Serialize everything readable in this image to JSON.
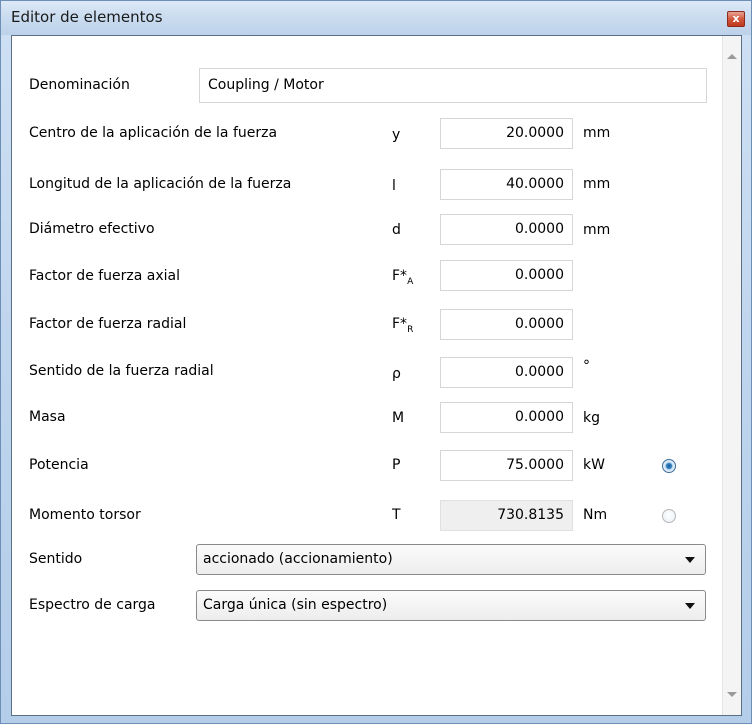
{
  "window": {
    "title": "Editor de elementos",
    "close_label": "x"
  },
  "form": {
    "denominacion": {
      "label": "Denominación",
      "value": "Coupling / Motor"
    },
    "rows": [
      {
        "label": "Centro de la aplicación de la fuerza",
        "symbol": "y",
        "value": "20.0000",
        "unit": "mm"
      },
      {
        "label": "Longitud de la aplicación de la fuerza",
        "symbol": "l",
        "value": "40.0000",
        "unit": "mm"
      },
      {
        "label": "Diámetro efectivo",
        "symbol": "d",
        "value": "0.0000",
        "unit": "mm"
      },
      {
        "label": "Factor de fuerza axial",
        "symbol": "F*",
        "symbol_sub": "A",
        "value": "0.0000",
        "unit": ""
      },
      {
        "label": "Factor de fuerza radial",
        "symbol": "F*",
        "symbol_sub": "R",
        "value": "0.0000",
        "unit": ""
      },
      {
        "label": "Sentido de la fuerza radial",
        "symbol": "ρ",
        "value": "0.0000",
        "unit": "°"
      },
      {
        "label": "Masa",
        "symbol": "M",
        "value": "0.0000",
        "unit": "kg"
      },
      {
        "label": "Potencia",
        "symbol": "P",
        "value": "75.0000",
        "unit": "kW",
        "radio": "checked"
      },
      {
        "label": "Momento torsor",
        "symbol": "T",
        "value": "730.8135",
        "unit": "Nm",
        "radio": "unchecked"
      }
    ],
    "sentido": {
      "label": "Sentido",
      "selected": "accionado (accionamiento)"
    },
    "espectro": {
      "label": "Espectro de carga",
      "selected": "Carga única (sin espectro)"
    }
  }
}
